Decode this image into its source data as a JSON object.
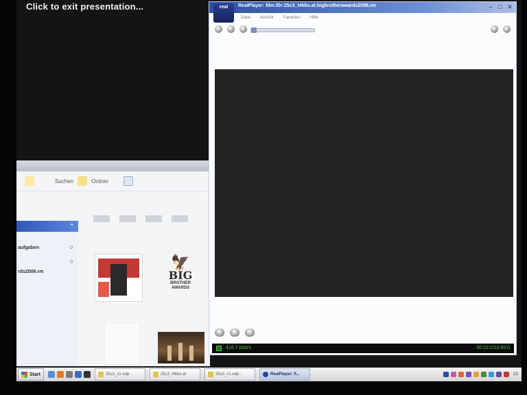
{
  "presentation": {
    "exit_hint": "Click to exit presentation..."
  },
  "explorer": {
    "toolbar": {
      "search_label": "Suchen",
      "folders_label": "Ordner"
    },
    "sidebar": {
      "link1": "aufgaben",
      "link1_count": "0",
      "link2_count": "0",
      "file_name": "rds2006.rm"
    }
  },
  "realplayer": {
    "logo_text": "real",
    "title": "RealPlayer: film:/Dr:25c3_t4kbs.at:bigbrotherawards2006.rm",
    "menu": [
      "Datei",
      "Ansicht",
      "Favoriten",
      "Hilfe"
    ],
    "status": {
      "bitrate": "416.7 Kbit/s",
      "time": "00:22:2/10:50:0"
    }
  },
  "taskbar": {
    "start_label": "Start",
    "tasks": [
      {
        "label": "25c3_v1.odp -"
      },
      {
        "label": "25c3_t4kbs.at"
      },
      {
        "label": "25c3_v1.odp -"
      },
      {
        "label": "RealPlayer: fi..."
      }
    ],
    "clock": "13:"
  },
  "colors": {
    "accent": "#2a4fa6",
    "status_text": "#4fc24a",
    "video_bg": "#242424"
  }
}
